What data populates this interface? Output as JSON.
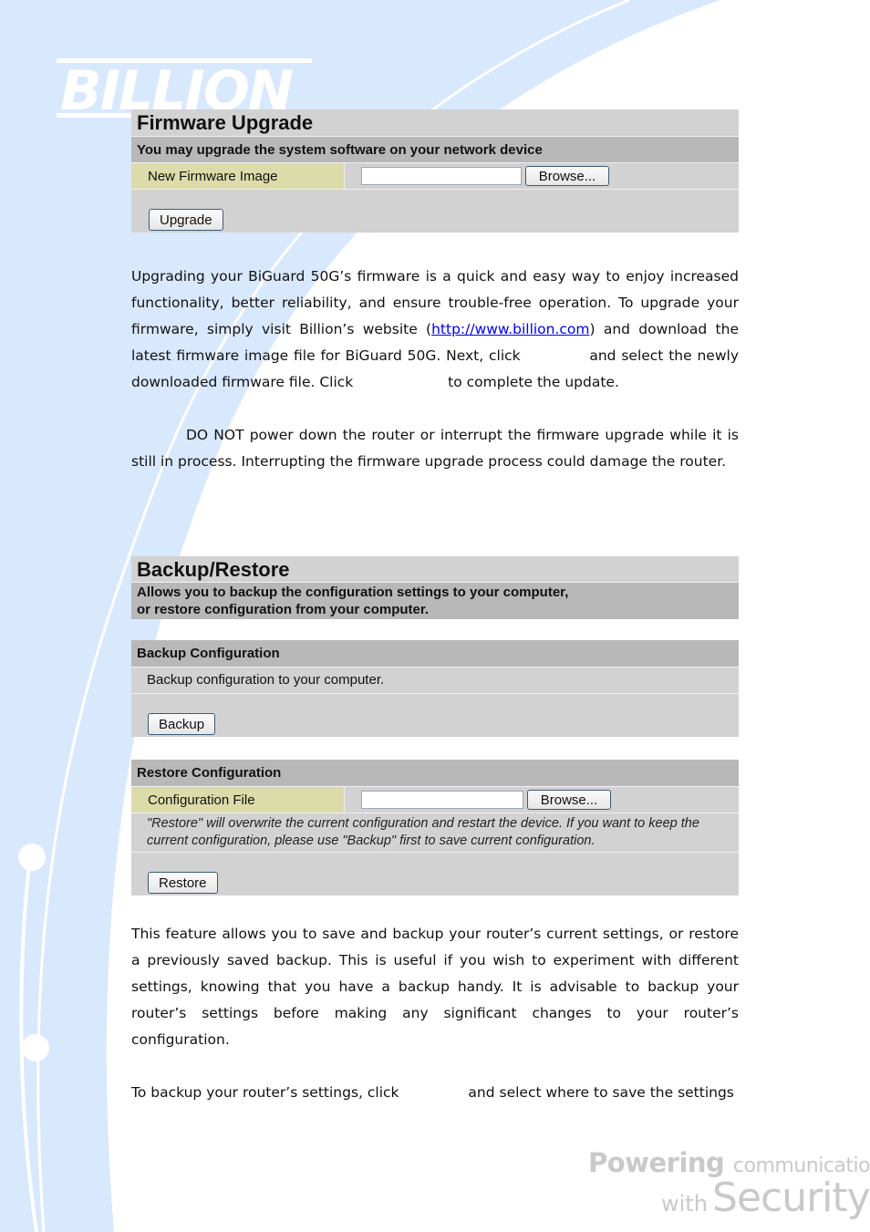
{
  "branding": {
    "logo_text": "BILLION",
    "tagline_bold": "Powering",
    "tagline_small": "communications",
    "tagline_with": "with",
    "tagline_security": "Security"
  },
  "firmware_panel": {
    "title": "Firmware Upgrade",
    "subtitle": "You may upgrade the system software on your network device",
    "field_label": "New Firmware Image",
    "file_value": "",
    "browse_label": "Browse...",
    "upgrade_label": "Upgrade"
  },
  "firmware_text": {
    "p1_part1": "Upgrading your BiGuard 50G’s firmware is a quick and easy way to enjoy increased functionality, better reliability, and ensure trouble-free operation. To upgrade your firmware, simply visit Billion’s website (",
    "link": "http://www.billion.com",
    "p1_part2": ") and download the latest firmware image file for BiGuard 50G. Next, click",
    "p1_part3": "and select the newly downloaded firmware file. Click",
    "p1_part4": "to complete the update.",
    "warning": "DO NOT power down the router or interrupt the firmware upgrade while it is still in process. Interrupting the firmware upgrade process could damage the router."
  },
  "backup_panel": {
    "title": "Backup/Restore",
    "subtitle_line1": "Allows you to backup the configuration settings to your computer,",
    "subtitle_line2": "or restore configuration from your computer.",
    "backup_header": "Backup Configuration",
    "backup_info": "Backup configuration to your computer.",
    "backup_label": "Backup",
    "restore_header": "Restore Configuration",
    "restore_field_label": "Configuration File",
    "restore_file_value": "",
    "browse_label": "Browse...",
    "restore_note": "\"Restore\" will overwrite the current configuration and restart the device. If you want to keep the current configuration, please use \"Backup\" first to save current configuration.",
    "restore_label": "Restore"
  },
  "backup_text": {
    "p1": "This feature allows you to save and backup your router’s current settings, or restore a previously saved backup. This is useful if you wish to experiment with different settings, knowing that you have a backup handy. It is advisable to backup your router’s settings before making any significant changes to your router’s configuration.",
    "p2_part1": "To backup your router’s settings, click",
    "p2_part2": "and select where to save the settings"
  }
}
